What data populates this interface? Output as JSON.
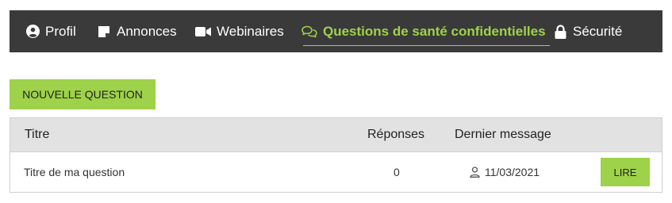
{
  "nav": {
    "items": [
      {
        "label": "Profil",
        "icon": "user-circle-icon"
      },
      {
        "label": "Annonces",
        "icon": "note-icon"
      },
      {
        "label": "Webinaires",
        "icon": "video-camera-icon"
      },
      {
        "label": "Questions de santé confidentielles",
        "icon": "chat-bubbles-icon",
        "active": true
      },
      {
        "label": "Sécurité",
        "icon": "lock-icon"
      }
    ],
    "active_color": "#9ed24a",
    "background": "#3a3a3a"
  },
  "actions": {
    "new_question_label": "NOUVELLE QUESTION"
  },
  "table": {
    "headers": {
      "title": "Titre",
      "replies": "Réponses",
      "last_message": "Dernier message"
    },
    "rows": [
      {
        "title": "Titre de ma question",
        "replies": "0",
        "last_message_date": "11/03/2021",
        "action_label": "LIRE"
      }
    ]
  },
  "accent_color": "#9ed24a"
}
